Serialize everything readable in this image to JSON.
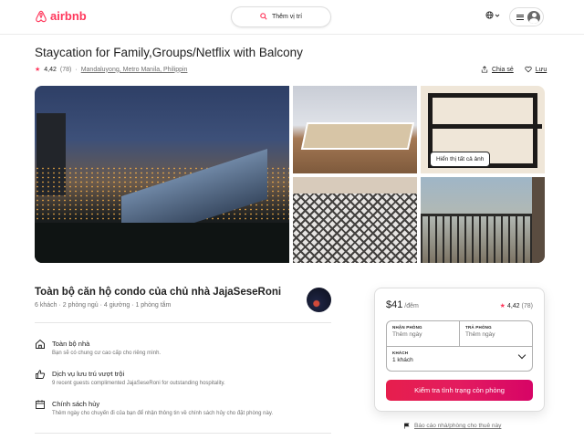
{
  "header": {
    "brand": "airbnb",
    "search_placeholder": "Thêm vị trí",
    "search_icon": "search-icon",
    "globe_icon": "globe-icon"
  },
  "listing": {
    "title": "Staycation for Family,Groups/Netflix with Balcony",
    "rating": "4,42",
    "reviews": "(78)",
    "location": "Mandaluyong, Metro Manila, Philippin",
    "share_label": "Chia sẻ",
    "save_label": "Lưu"
  },
  "gallery": {
    "show_all_label": "Hiển thị tất cả ảnh"
  },
  "host": {
    "title": "Toàn bộ căn hộ condo của chủ nhà JajaSeseRoni",
    "details": "6 khách · 2 phòng ngủ · 4 giường · 1 phòng tắm"
  },
  "features": [
    {
      "icon": "home-icon",
      "title": "Toàn bộ nhà",
      "desc": "Bạn sẽ có chung cư cao cấp cho riêng mình."
    },
    {
      "icon": "thumbs-up-icon",
      "title": "Dịch vụ lưu trú vượt trội",
      "desc": "9 recent guests complimented JajaSeseRoni for outstanding hospitality."
    },
    {
      "icon": "calendar-icon",
      "title": "Chính sách hủy",
      "desc": "Thêm ngày cho chuyến đi của bạn để nhận thông tin về chính sách hủy cho đặt phòng này."
    }
  ],
  "booking": {
    "price": "$41",
    "per_night": " /đêm",
    "rating": "4,42",
    "reviews": "(78)",
    "checkin_label": "NHẬN PHÒNG",
    "checkin_value": "Thêm ngày",
    "checkout_label": "TRẢ PHÒNG",
    "checkout_value": "Thêm ngày",
    "guests_label": "KHÁCH",
    "guests_value": "1 khách",
    "cta_label": "Kiểm tra tình trạng còn phòng",
    "report_label": "Báo cáo nhà/phòng cho thuê này"
  },
  "colors": {
    "brand": "#ff385c",
    "text": "#222222",
    "muted": "#717171"
  }
}
